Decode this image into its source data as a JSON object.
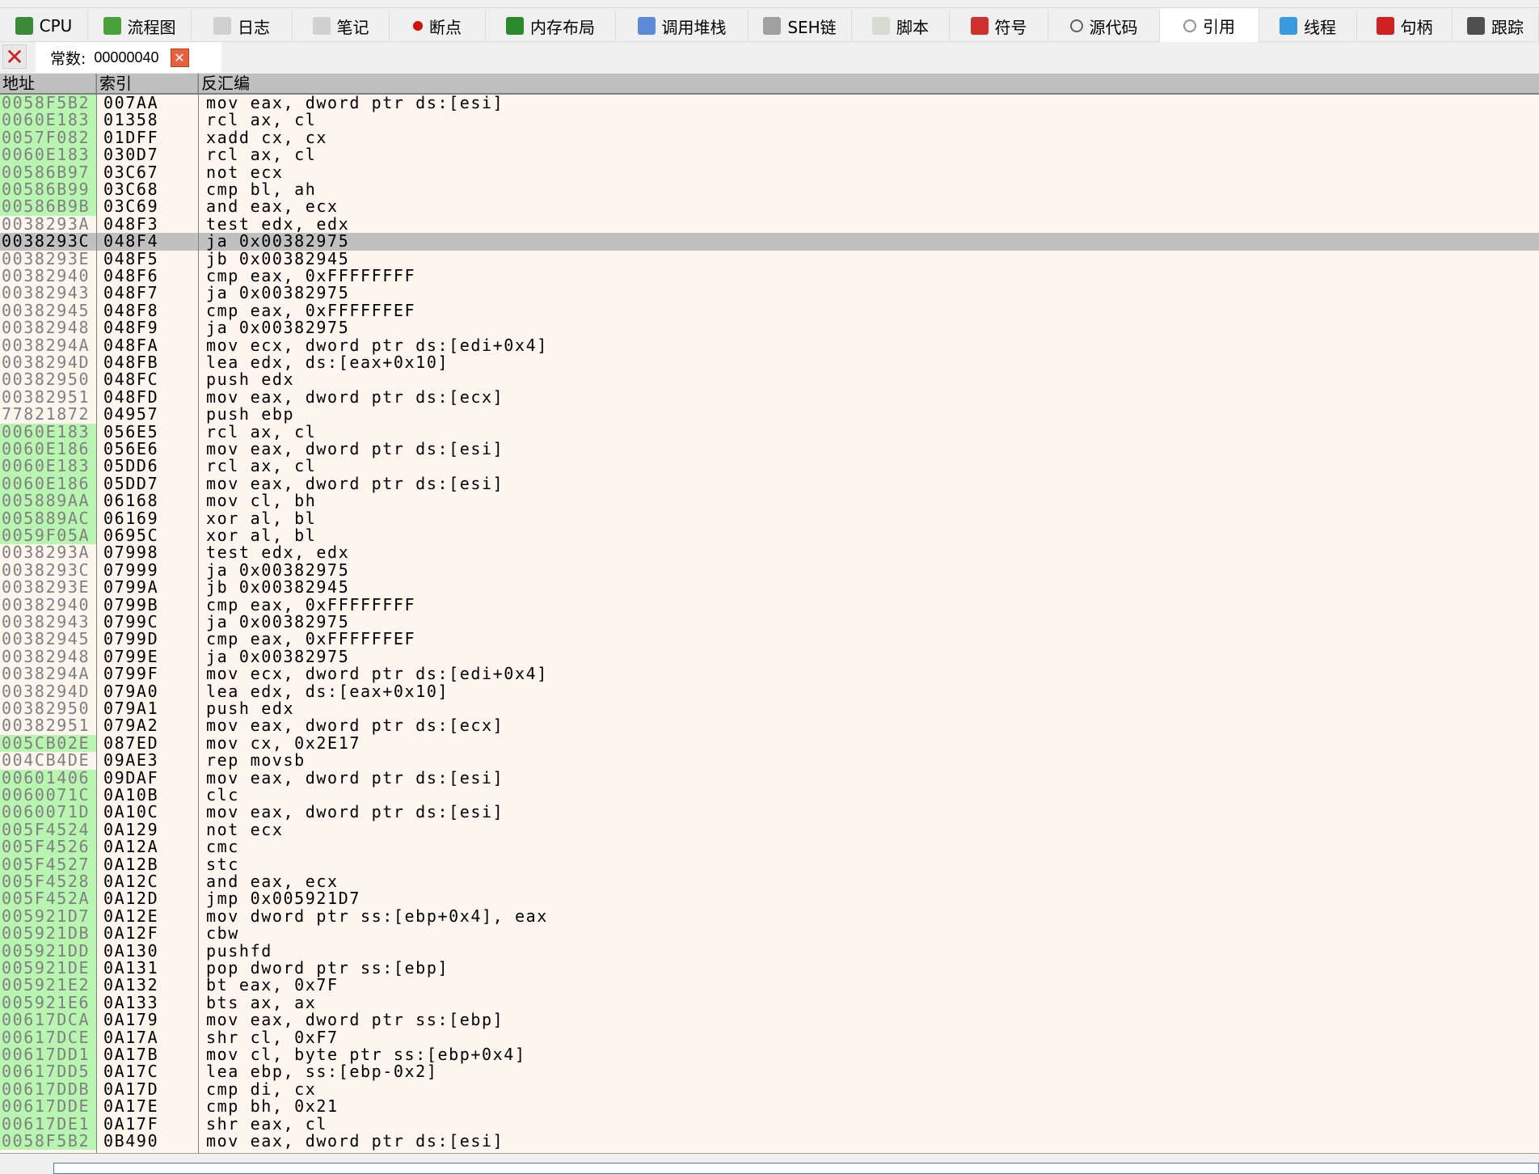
{
  "tabs": [
    {
      "label": "CPU",
      "icon": "cpu-icon",
      "color": "#3a8a3a"
    },
    {
      "label": "流程图",
      "icon": "tree-icon",
      "color": "#4aa03a"
    },
    {
      "label": "日志",
      "icon": "log-icon",
      "color": "#d0d0d0"
    },
    {
      "label": "笔记",
      "icon": "notes-icon",
      "color": "#d0d0d0"
    },
    {
      "label": "断点",
      "icon": "breakpoint-icon",
      "color": "#d01010"
    },
    {
      "label": "内存布局",
      "icon": "memory-icon",
      "color": "#2a8a2a"
    },
    {
      "label": "调用堆栈",
      "icon": "callstack-icon",
      "color": "#5a8ad8"
    },
    {
      "label": "SEH链",
      "icon": "seh-chain-icon",
      "color": "#a0a0a0"
    },
    {
      "label": "脚本",
      "icon": "script-icon",
      "color": "#d8dcd0"
    },
    {
      "label": "符号",
      "icon": "symbol-icon",
      "color": "#d03030"
    },
    {
      "label": "源代码",
      "icon": "source-code-icon",
      "color": "#606060"
    },
    {
      "label": "引用",
      "icon": "search-icon",
      "color": "#909090",
      "active": true
    },
    {
      "label": "线程",
      "icon": "thread-icon",
      "color": "#3a9ae0"
    },
    {
      "label": "句柄",
      "icon": "handle-icon",
      "color": "#d02020"
    },
    {
      "label": "跟踪",
      "icon": "trace-icon",
      "color": "#505050"
    }
  ],
  "search": {
    "label": "常数:",
    "value": "00000040"
  },
  "columns": {
    "address": "地址",
    "index": "索引",
    "disasm": "反汇编"
  },
  "colors": {
    "highlight": "#b8f5b0",
    "selected": "#c0c0c0",
    "background": "#fdf6ee"
  },
  "selected_row": 8,
  "rows": [
    [
      "0058F5B2",
      "007AA",
      "mov eax, dword ptr ds:[esi]",
      1
    ],
    [
      "0060E183",
      "01358",
      "rcl ax, cl",
      1
    ],
    [
      "0057F082",
      "01DFF",
      "xadd cx, cx",
      1
    ],
    [
      "0060E183",
      "030D7",
      "rcl ax, cl",
      1
    ],
    [
      "00586B97",
      "03C67",
      "not ecx",
      1
    ],
    [
      "00586B99",
      "03C68",
      "cmp bl, ah",
      1
    ],
    [
      "00586B9B",
      "03C69",
      "and eax, ecx",
      1
    ],
    [
      "0038293A",
      "048F3",
      "test edx, edx",
      0
    ],
    [
      "0038293C",
      "048F4",
      "ja 0x00382975",
      0
    ],
    [
      "0038293E",
      "048F5",
      "jb 0x00382945",
      0
    ],
    [
      "00382940",
      "048F6",
      "cmp eax, 0xFFFFFFFF",
      0
    ],
    [
      "00382943",
      "048F7",
      "ja 0x00382975",
      0
    ],
    [
      "00382945",
      "048F8",
      "cmp eax, 0xFFFFFFEF",
      0
    ],
    [
      "00382948",
      "048F9",
      "ja 0x00382975",
      0
    ],
    [
      "0038294A",
      "048FA",
      "mov ecx, dword ptr ds:[edi+0x4]",
      0
    ],
    [
      "0038294D",
      "048FB",
      "lea edx, ds:[eax+0x10]",
      0
    ],
    [
      "00382950",
      "048FC",
      "push edx",
      0
    ],
    [
      "00382951",
      "048FD",
      "mov eax, dword ptr ds:[ecx]",
      0
    ],
    [
      "77821872",
      "04957",
      "push ebp",
      0
    ],
    [
      "0060E183",
      "056E5",
      "rcl ax, cl",
      1
    ],
    [
      "0060E186",
      "056E6",
      "mov eax, dword ptr ds:[esi]",
      1
    ],
    [
      "0060E183",
      "05DD6",
      "rcl ax, cl",
      1
    ],
    [
      "0060E186",
      "05DD7",
      "mov eax, dword ptr ds:[esi]",
      1
    ],
    [
      "005889AA",
      "06168",
      "mov cl, bh",
      1
    ],
    [
      "005889AC",
      "06169",
      "xor al, bl",
      1
    ],
    [
      "0059F05A",
      "0695C",
      "xor al, bl",
      1
    ],
    [
      "0038293A",
      "07998",
      "test edx, edx",
      0
    ],
    [
      "0038293C",
      "07999",
      "ja 0x00382975",
      0
    ],
    [
      "0038293E",
      "0799A",
      "jb 0x00382945",
      0
    ],
    [
      "00382940",
      "0799B",
      "cmp eax, 0xFFFFFFFF",
      0
    ],
    [
      "00382943",
      "0799C",
      "ja 0x00382975",
      0
    ],
    [
      "00382945",
      "0799D",
      "cmp eax, 0xFFFFFFEF",
      0
    ],
    [
      "00382948",
      "0799E",
      "ja 0x00382975",
      0
    ],
    [
      "0038294A",
      "0799F",
      "mov ecx, dword ptr ds:[edi+0x4]",
      0
    ],
    [
      "0038294D",
      "079A0",
      "lea edx, ds:[eax+0x10]",
      0
    ],
    [
      "00382950",
      "079A1",
      "push edx",
      0
    ],
    [
      "00382951",
      "079A2",
      "mov eax, dword ptr ds:[ecx]",
      0
    ],
    [
      "005CB02E",
      "087ED",
      "mov cx, 0x2E17",
      1
    ],
    [
      "004CB4DE",
      "09AE3",
      "rep movsb",
      0
    ],
    [
      "00601406",
      "09DAF",
      "mov eax, dword ptr ds:[esi]",
      1
    ],
    [
      "0060071C",
      "0A10B",
      "clc",
      1
    ],
    [
      "0060071D",
      "0A10C",
      "mov eax, dword ptr ds:[esi]",
      1
    ],
    [
      "005F4524",
      "0A129",
      "not ecx",
      1
    ],
    [
      "005F4526",
      "0A12A",
      "cmc",
      1
    ],
    [
      "005F4527",
      "0A12B",
      "stc",
      1
    ],
    [
      "005F4528",
      "0A12C",
      "and eax, ecx",
      1
    ],
    [
      "005F452A",
      "0A12D",
      "jmp 0x005921D7",
      1
    ],
    [
      "005921D7",
      "0A12E",
      "mov dword ptr ss:[ebp+0x4], eax",
      1
    ],
    [
      "005921DB",
      "0A12F",
      "cbw",
      1
    ],
    [
      "005921DD",
      "0A130",
      "pushfd",
      1
    ],
    [
      "005921DE",
      "0A131",
      "pop dword ptr ss:[ebp]",
      1
    ],
    [
      "005921E2",
      "0A132",
      "bt eax, 0x7F",
      1
    ],
    [
      "005921E6",
      "0A133",
      "bts ax, ax",
      1
    ],
    [
      "00617DCA",
      "0A179",
      "mov eax, dword ptr ss:[ebp]",
      1
    ],
    [
      "00617DCE",
      "0A17A",
      "shr cl, 0xF7",
      1
    ],
    [
      "00617DD1",
      "0A17B",
      "mov cl, byte ptr ss:[ebp+0x4]",
      1
    ],
    [
      "00617DD5",
      "0A17C",
      "lea ebp, ss:[ebp-0x2]",
      1
    ],
    [
      "00617DDB",
      "0A17D",
      "cmp di, cx",
      1
    ],
    [
      "00617DDE",
      "0A17E",
      "cmp bh, 0x21",
      1
    ],
    [
      "00617DE1",
      "0A17F",
      "shr eax, cl",
      1
    ],
    [
      "0058F5B2",
      "0B490",
      "mov eax, dword ptr ds:[esi]",
      1
    ]
  ]
}
